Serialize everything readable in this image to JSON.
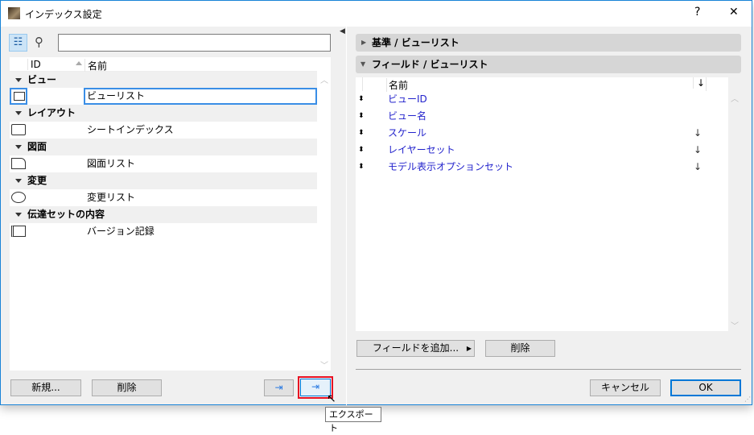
{
  "window": {
    "title": "インデックス設定",
    "help": "?",
    "close": "✕"
  },
  "left": {
    "search_placeholder": "",
    "columns": {
      "id": "ID",
      "name": "名前"
    },
    "groups": [
      {
        "label": "ビュー",
        "item": "ビューリスト"
      },
      {
        "label": "レイアウト",
        "item": "シートインデックス"
      },
      {
        "label": "図面",
        "item": "図面リスト"
      },
      {
        "label": "変更",
        "item": "変更リスト"
      },
      {
        "label": "伝達セットの内容",
        "item": "バージョン記録"
      }
    ],
    "new_button": "新規...",
    "delete_button": "削除"
  },
  "right": {
    "criteria_header": "基準 /  ビューリスト",
    "fields_header": "フィールド /  ビューリスト",
    "fields_column": "名前",
    "sort_arrow": "↓",
    "fields": [
      {
        "name": "ビューID",
        "sorted": false
      },
      {
        "name": "ビュー名",
        "sorted": false
      },
      {
        "name": "スケール",
        "sorted": true
      },
      {
        "name": "レイヤーセット",
        "sorted": true
      },
      {
        "name": "モデル表示オプションセット",
        "sorted": true
      }
    ],
    "add_field_button": "フィールドを追加...",
    "delete_button": "削除",
    "cancel_button": "キャンセル",
    "ok_button": "OK"
  },
  "tooltip": "エクスポート",
  "colors": {
    "accent": "#0078d7",
    "highlight": "#e81123",
    "field_text": "#2222cc"
  }
}
